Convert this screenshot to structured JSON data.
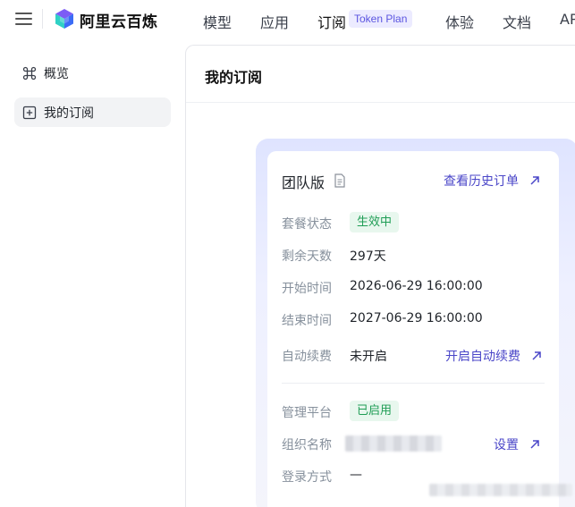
{
  "header": {
    "brand": "阿里云百炼",
    "nav": [
      {
        "label": "模型"
      },
      {
        "label": "应用"
      },
      {
        "label": "订阅",
        "active": true
      },
      {
        "label": "体验"
      },
      {
        "label": "文档"
      },
      {
        "label": "AP"
      }
    ],
    "subscription_badge": "Token Plan"
  },
  "sidebar": {
    "items": [
      {
        "label": "概览",
        "icon": "command-icon"
      },
      {
        "label": "我的订阅",
        "icon": "plus-square-icon",
        "active": true
      }
    ]
  },
  "main": {
    "title": "我的订阅",
    "plan": {
      "name": "团队版",
      "history_link": "查看历史订单",
      "rows": [
        {
          "label": "套餐状态",
          "value": "生效中"
        },
        {
          "label": "剩余天数",
          "value": "297天"
        },
        {
          "label": "开始时间",
          "value": "2026-06-29 16:00:00"
        },
        {
          "label": "结束时间",
          "value": "2027-06-29 16:00:00"
        },
        {
          "label": "自动续费",
          "value": "未开启",
          "action": "开启自动续费"
        }
      ],
      "platform_rows": [
        {
          "label": "管理平台",
          "value": "已启用"
        },
        {
          "label": "组织名称",
          "action": "设置"
        },
        {
          "label": "登录方式",
          "value": "—"
        }
      ]
    }
  },
  "colors": {
    "accent": "#4a46c8",
    "badge_bg": "#ecebff",
    "status_green": "#1f9d55",
    "status_green_bg": "#e8f7ee",
    "card_gradient_top": "#dfe4ff"
  }
}
